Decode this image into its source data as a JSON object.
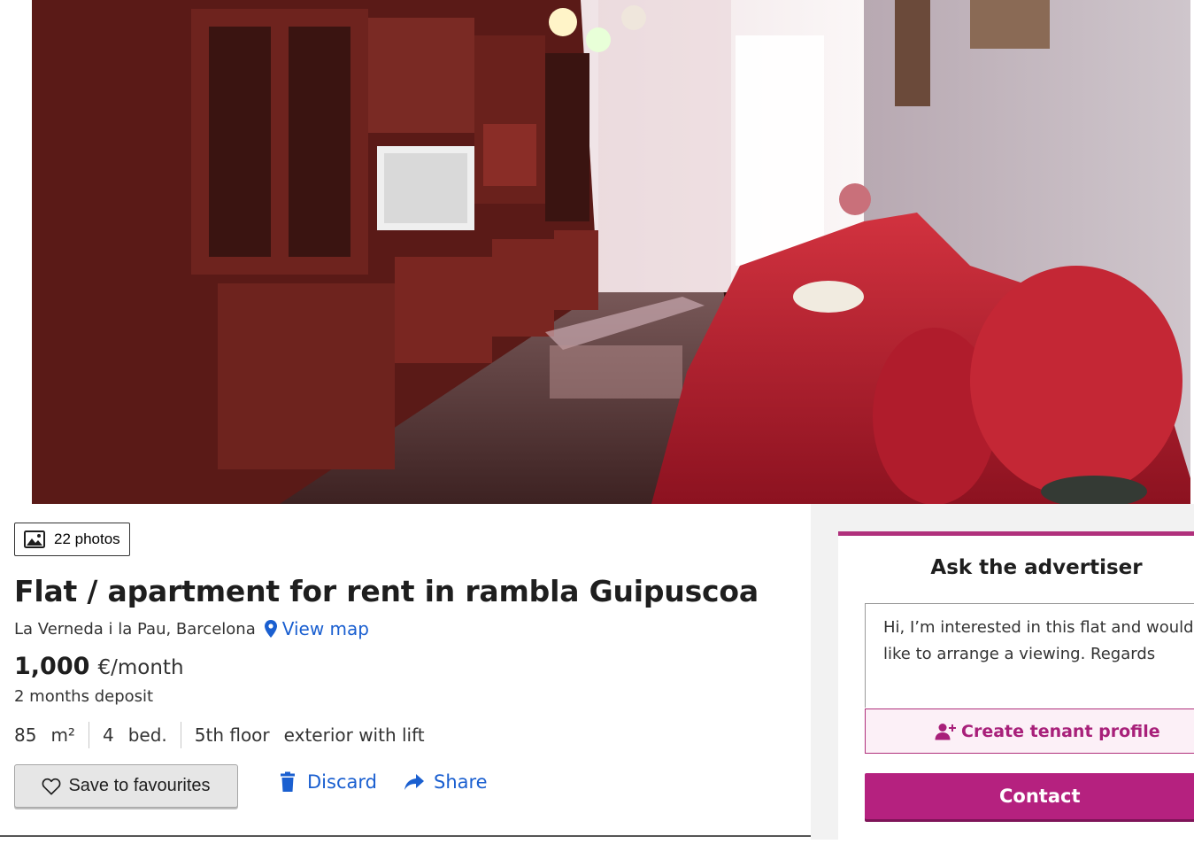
{
  "gallery": {
    "photos_label": "22 photos",
    "photo_subject": "living room with red sofa and wooden cabinets"
  },
  "listing": {
    "title": "Flat / apartment for rent in rambla Guipuscoa",
    "location": "La Verneda i la Pau, Barcelona",
    "view_map_label": "View map",
    "price_amount": "1,000",
    "price_unit": "€/month",
    "deposit": "2 months deposit",
    "features": {
      "area_value": "85",
      "area_unit": "m²",
      "bed_value": "4",
      "bed_unit": "bed.",
      "floor": "5th floor",
      "floor_detail": "exterior with lift"
    }
  },
  "actions": {
    "save_label": "Save to favourites",
    "discard_label": "Discard",
    "share_label": "Share"
  },
  "contact_card": {
    "title": "Ask the advertiser",
    "message": "Hi, I’m interested in this flat and would like to arrange a viewing. Regards",
    "tenant_profile_label": "Create tenant profile",
    "contact_label": "Contact"
  },
  "colors": {
    "brand": "#b5217f",
    "link": "#1a5fd0",
    "text": "#1e1e1e"
  },
  "icons": [
    "image-icon",
    "map-pin-icon",
    "heart-icon",
    "trash-icon",
    "share-arrow-icon",
    "add-user-icon"
  ]
}
